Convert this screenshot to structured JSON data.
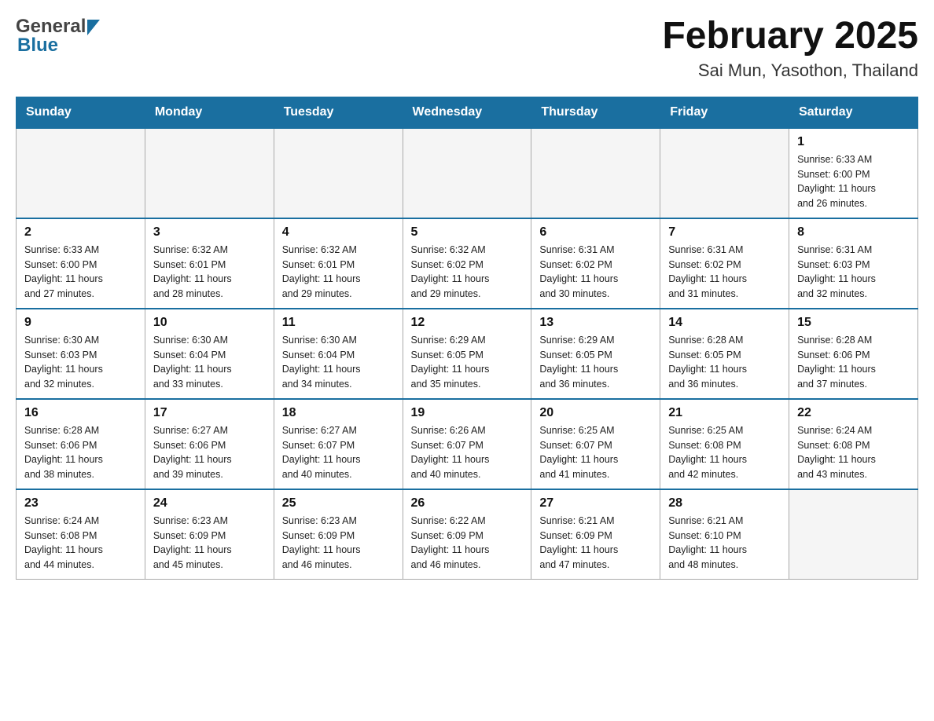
{
  "header": {
    "logo_general": "General",
    "logo_blue": "Blue",
    "title": "February 2025",
    "subtitle": "Sai Mun, Yasothon, Thailand"
  },
  "weekdays": [
    "Sunday",
    "Monday",
    "Tuesday",
    "Wednesday",
    "Thursday",
    "Friday",
    "Saturday"
  ],
  "weeks": [
    [
      {
        "day": "",
        "info": ""
      },
      {
        "day": "",
        "info": ""
      },
      {
        "day": "",
        "info": ""
      },
      {
        "day": "",
        "info": ""
      },
      {
        "day": "",
        "info": ""
      },
      {
        "day": "",
        "info": ""
      },
      {
        "day": "1",
        "info": "Sunrise: 6:33 AM\nSunset: 6:00 PM\nDaylight: 11 hours\nand 26 minutes."
      }
    ],
    [
      {
        "day": "2",
        "info": "Sunrise: 6:33 AM\nSunset: 6:00 PM\nDaylight: 11 hours\nand 27 minutes."
      },
      {
        "day": "3",
        "info": "Sunrise: 6:32 AM\nSunset: 6:01 PM\nDaylight: 11 hours\nand 28 minutes."
      },
      {
        "day": "4",
        "info": "Sunrise: 6:32 AM\nSunset: 6:01 PM\nDaylight: 11 hours\nand 29 minutes."
      },
      {
        "day": "5",
        "info": "Sunrise: 6:32 AM\nSunset: 6:02 PM\nDaylight: 11 hours\nand 29 minutes."
      },
      {
        "day": "6",
        "info": "Sunrise: 6:31 AM\nSunset: 6:02 PM\nDaylight: 11 hours\nand 30 minutes."
      },
      {
        "day": "7",
        "info": "Sunrise: 6:31 AM\nSunset: 6:02 PM\nDaylight: 11 hours\nand 31 minutes."
      },
      {
        "day": "8",
        "info": "Sunrise: 6:31 AM\nSunset: 6:03 PM\nDaylight: 11 hours\nand 32 minutes."
      }
    ],
    [
      {
        "day": "9",
        "info": "Sunrise: 6:30 AM\nSunset: 6:03 PM\nDaylight: 11 hours\nand 32 minutes."
      },
      {
        "day": "10",
        "info": "Sunrise: 6:30 AM\nSunset: 6:04 PM\nDaylight: 11 hours\nand 33 minutes."
      },
      {
        "day": "11",
        "info": "Sunrise: 6:30 AM\nSunset: 6:04 PM\nDaylight: 11 hours\nand 34 minutes."
      },
      {
        "day": "12",
        "info": "Sunrise: 6:29 AM\nSunset: 6:05 PM\nDaylight: 11 hours\nand 35 minutes."
      },
      {
        "day": "13",
        "info": "Sunrise: 6:29 AM\nSunset: 6:05 PM\nDaylight: 11 hours\nand 36 minutes."
      },
      {
        "day": "14",
        "info": "Sunrise: 6:28 AM\nSunset: 6:05 PM\nDaylight: 11 hours\nand 36 minutes."
      },
      {
        "day": "15",
        "info": "Sunrise: 6:28 AM\nSunset: 6:06 PM\nDaylight: 11 hours\nand 37 minutes."
      }
    ],
    [
      {
        "day": "16",
        "info": "Sunrise: 6:28 AM\nSunset: 6:06 PM\nDaylight: 11 hours\nand 38 minutes."
      },
      {
        "day": "17",
        "info": "Sunrise: 6:27 AM\nSunset: 6:06 PM\nDaylight: 11 hours\nand 39 minutes."
      },
      {
        "day": "18",
        "info": "Sunrise: 6:27 AM\nSunset: 6:07 PM\nDaylight: 11 hours\nand 40 minutes."
      },
      {
        "day": "19",
        "info": "Sunrise: 6:26 AM\nSunset: 6:07 PM\nDaylight: 11 hours\nand 40 minutes."
      },
      {
        "day": "20",
        "info": "Sunrise: 6:25 AM\nSunset: 6:07 PM\nDaylight: 11 hours\nand 41 minutes."
      },
      {
        "day": "21",
        "info": "Sunrise: 6:25 AM\nSunset: 6:08 PM\nDaylight: 11 hours\nand 42 minutes."
      },
      {
        "day": "22",
        "info": "Sunrise: 6:24 AM\nSunset: 6:08 PM\nDaylight: 11 hours\nand 43 minutes."
      }
    ],
    [
      {
        "day": "23",
        "info": "Sunrise: 6:24 AM\nSunset: 6:08 PM\nDaylight: 11 hours\nand 44 minutes."
      },
      {
        "day": "24",
        "info": "Sunrise: 6:23 AM\nSunset: 6:09 PM\nDaylight: 11 hours\nand 45 minutes."
      },
      {
        "day": "25",
        "info": "Sunrise: 6:23 AM\nSunset: 6:09 PM\nDaylight: 11 hours\nand 46 minutes."
      },
      {
        "day": "26",
        "info": "Sunrise: 6:22 AM\nSunset: 6:09 PM\nDaylight: 11 hours\nand 46 minutes."
      },
      {
        "day": "27",
        "info": "Sunrise: 6:21 AM\nSunset: 6:09 PM\nDaylight: 11 hours\nand 47 minutes."
      },
      {
        "day": "28",
        "info": "Sunrise: 6:21 AM\nSunset: 6:10 PM\nDaylight: 11 hours\nand 48 minutes."
      },
      {
        "day": "",
        "info": ""
      }
    ]
  ]
}
